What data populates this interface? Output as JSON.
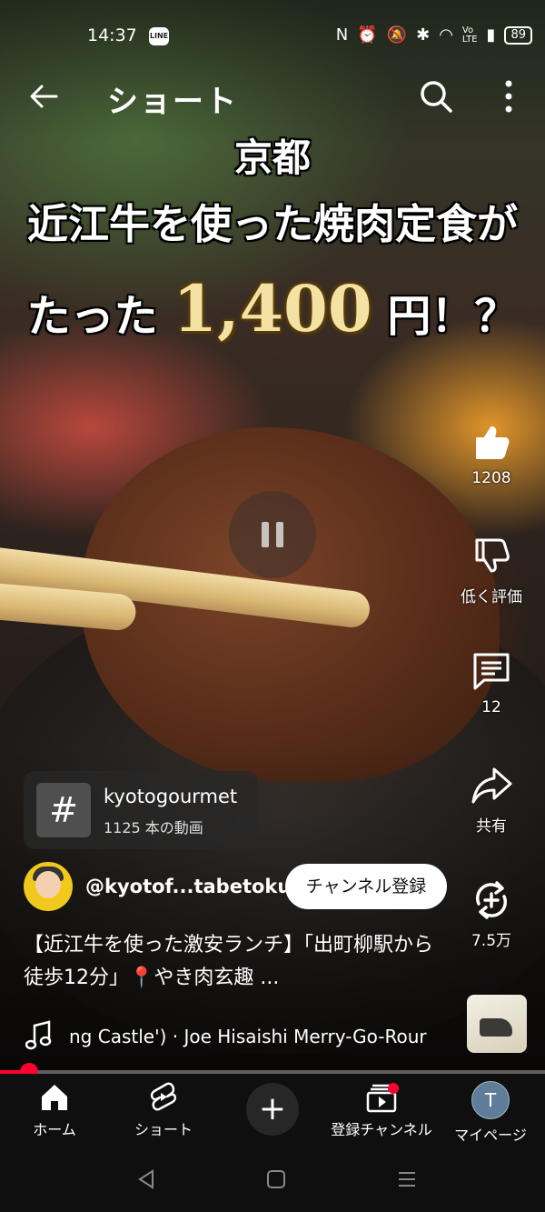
{
  "status_bar": {
    "time": "14:37",
    "line_app": "LINE",
    "battery": "89"
  },
  "header": {
    "title": "ショート"
  },
  "video_captions": {
    "line1": "京都",
    "line2": "近江牛を使った焼肉定食が",
    "line3_prefix": "たった",
    "line3_price": "1,400",
    "line3_suffix": "円！？"
  },
  "actions": {
    "like_count": "1208",
    "dislike_label": "低く評価",
    "comment_count": "12",
    "share_label": "共有",
    "remix_count": "7.5万"
  },
  "hashtag": {
    "symbol": "#",
    "name": "kyotogourmet",
    "count": "1125 本の動画"
  },
  "channel": {
    "handle": "@kyotof...tabetoku",
    "subscribe_label": "チャンネル登録"
  },
  "description": "【近江牛を使った激安ランチ】「出町柳駅から徒歩12分」📍やき肉玄趣 ...",
  "music": {
    "track": "ng Castle') · Joe Hisaishi     Merry-Go-Rour"
  },
  "playback": {
    "progress_fraction": 0.05
  },
  "bottom_nav": {
    "home": "ホーム",
    "shorts": "ショート",
    "create": "+",
    "subscriptions": "登録チャンネル",
    "me_label": "マイページ",
    "me_initial": "T"
  },
  "colors": {
    "accent": "#ff0033",
    "nav_bg": "#0f0f0f"
  }
}
